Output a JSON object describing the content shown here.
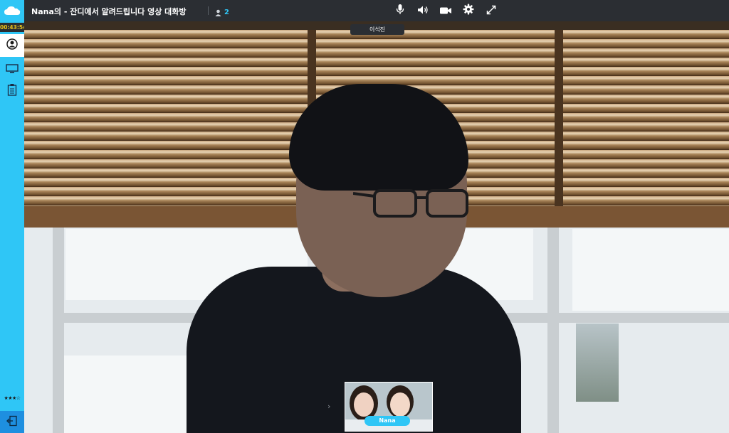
{
  "app": {
    "room_title": "Nana의 - 잔디에서 알려드립니다 영상 대화방",
    "participant_count": "2",
    "timer": "00:43:54",
    "rating": "★★★☆"
  },
  "sidebar": {
    "items": [
      {
        "name": "profile",
        "icon": "user-circle-icon",
        "active": true
      },
      {
        "name": "screen-share",
        "icon": "monitor-icon",
        "active": false
      },
      {
        "name": "notes",
        "icon": "clipboard-icon",
        "active": false
      }
    ],
    "exit_icon": "exit-icon"
  },
  "toolbar": {
    "controls": [
      {
        "name": "microphone",
        "icon": "microphone-icon"
      },
      {
        "name": "speaker",
        "icon": "speaker-icon"
      },
      {
        "name": "camera",
        "icon": "video-camera-icon"
      },
      {
        "name": "settings",
        "icon": "gear-icon"
      },
      {
        "name": "fullscreen",
        "icon": "expand-icon"
      }
    ]
  },
  "video": {
    "remote_name": "이석진"
  },
  "self_view": {
    "name": "Nana"
  },
  "colors": {
    "accent": "#2fc6f6",
    "topbar": "#2b2e33",
    "timer": "#e9c21b",
    "exit": "#1e8fe0"
  }
}
